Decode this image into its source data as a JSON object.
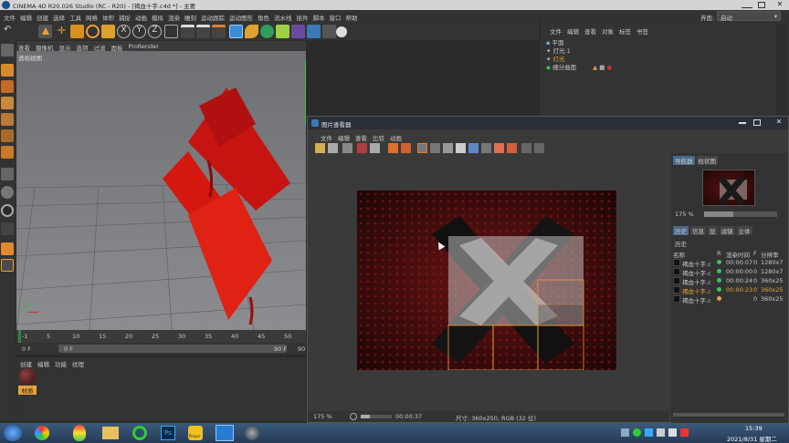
{
  "app": {
    "title": "CINEMA 4D R20.026 Studio (RC - R20) - [褐血十字.c4d *] - 主要",
    "interface_label": "界面:",
    "interface_value": "启动"
  },
  "menubar": [
    "文件",
    "编辑",
    "创建",
    "选择",
    "工具",
    "网格",
    "体积",
    "捕捉",
    "动画",
    "模拟",
    "渲染",
    "雕刻",
    "运动跟踪",
    "运动图形",
    "角色",
    "流水线",
    "插件",
    "脚本",
    "窗口",
    "帮助"
  ],
  "toolbar_axes": [
    "X",
    "Y",
    "Z"
  ],
  "viewport": {
    "menu": [
      "查看",
      "摄像机",
      "显示",
      "选项",
      "过滤",
      "面板",
      "ProRender"
    ],
    "label": "透视视图"
  },
  "timeline": {
    "ticks": [
      "-1",
      "5",
      "10",
      "15",
      "20",
      "25",
      "30",
      "35",
      "40",
      "45",
      "50"
    ],
    "frame_field": "0 F",
    "start_field": "0 F",
    "end_field": "90 F",
    "end_label": "90"
  },
  "material_manager": {
    "menu": [
      "创建",
      "编辑",
      "功能",
      "纹理"
    ],
    "material_label": "材质"
  },
  "object_manager": {
    "menu": [
      "文件",
      "编辑",
      "查看",
      "对象",
      "标签",
      "书签"
    ],
    "objects": [
      "平面",
      "灯光.1",
      "灯光",
      "细分曲面"
    ]
  },
  "picture_viewer": {
    "title": "图片查看器",
    "menu": [
      "文件",
      "编辑",
      "查看",
      "比较",
      "动画"
    ],
    "nav_tabs": [
      "导航器",
      "柱状图"
    ],
    "zoom_side": "175 %",
    "zoom_bottom": "175 %",
    "time": "00:00:37",
    "status": "尺寸: 360x250, RGB (32 位)",
    "history_tabs": [
      "历史",
      "信息",
      "层",
      "滤镜",
      "立体"
    ],
    "history_label": "历史",
    "history_columns": [
      "名称",
      "R",
      "渲染时间",
      "F",
      "分辨率"
    ],
    "history": [
      {
        "name": "褐血十字.c",
        "time": "00:00:07",
        "f": "0",
        "res": "1280x7",
        "status_color": "#3fbf5f",
        "active": false
      },
      {
        "name": "褐血十字.c",
        "time": "00:00:00",
        "f": "0",
        "res": "1280x7",
        "status_color": "#3fbf5f",
        "active": false
      },
      {
        "name": "褐血十字.c",
        "time": "00:00:24",
        "f": "0",
        "res": "360x25",
        "status_color": "#3fbf5f",
        "active": false
      },
      {
        "name": "褐血十字.c",
        "time": "00:00:23",
        "f": "0",
        "res": "360x25",
        "status_color": "#3fbf5f",
        "active": true
      },
      {
        "name": "褐血十字.c",
        "time": "",
        "f": "0",
        "res": "360x25",
        "status_color": "#e6a23c",
        "active": false
      }
    ]
  },
  "taskbar": {
    "time": "15:39",
    "date": "2021/8/31 星期二",
    "app_label_player": "Player"
  },
  "colors": {
    "accent_orange": "#e6a23c",
    "selection_blue": "#4a6a8a",
    "render_red": "#5a0c0c"
  }
}
